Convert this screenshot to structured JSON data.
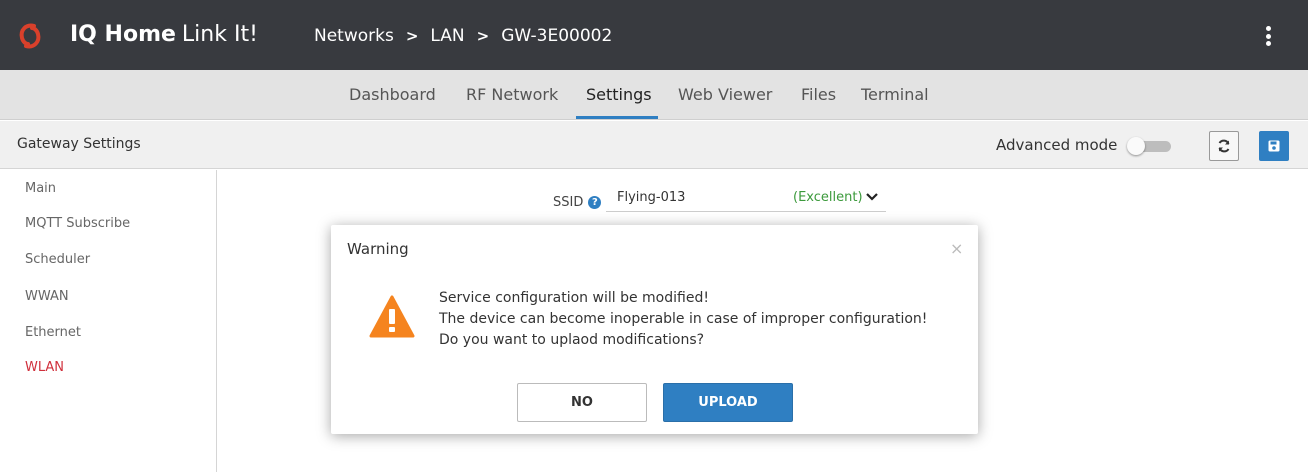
{
  "app": {
    "brand_bold": "IQ Home",
    "brand_light": "Link It!",
    "logo_icon": "link-icon",
    "menu_icon": "kebab-menu-icon"
  },
  "breadcrumb": {
    "items": [
      "Networks",
      "LAN",
      "GW-3E00002"
    ],
    "separator": ">"
  },
  "tabs": {
    "items": [
      "Dashboard",
      "RF Network",
      "Settings",
      "Web Viewer",
      "Files",
      "Terminal"
    ],
    "active": "Settings"
  },
  "settings_header": {
    "title": "Gateway Settings",
    "advanced_mode_label": "Advanced mode",
    "advanced_mode_on": false,
    "refresh_icon": "refresh-icon",
    "save_icon": "save-icon"
  },
  "sidebar": {
    "items": [
      "Main",
      "MQTT Subscribe",
      "Scheduler",
      "WWAN",
      "Ethernet",
      "WLAN"
    ],
    "active": "WLAN"
  },
  "form": {
    "ssid_label": "SSID",
    "ssid_value": "Flying-013",
    "ssid_quality": "(Excellent)"
  },
  "modal": {
    "title": "Warning",
    "close_symbol": "×",
    "icon": "warning-triangle-icon",
    "message_lines": [
      "Service configuration will be modified!",
      "The device can become inoperable in case of improper configuration!",
      "Do you want to uplaod modifications?"
    ],
    "no_label": "NO",
    "upload_label": "UPLOAD"
  },
  "colors": {
    "topbar": "#383a3f",
    "accent": "#2f7fc2",
    "active_sidebar": "#d0303c",
    "quality_green": "#3c9a3c",
    "warning_orange": "#f5841f"
  }
}
